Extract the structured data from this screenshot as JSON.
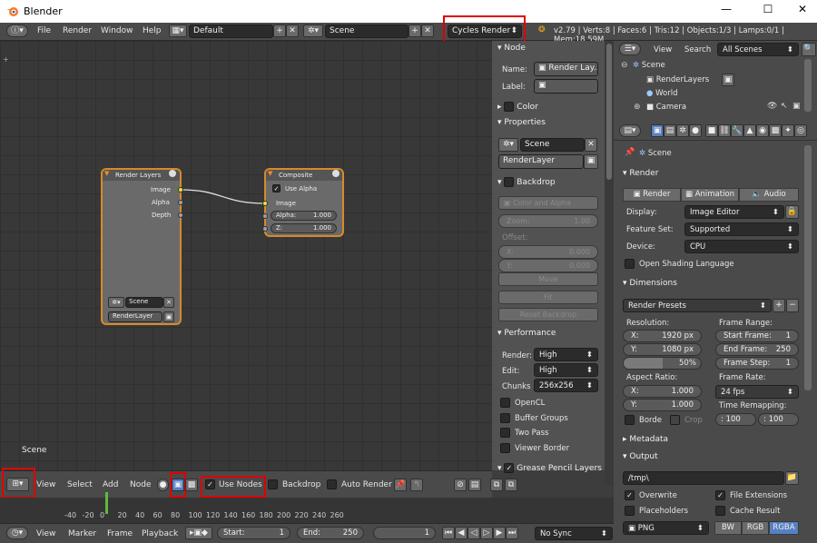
{
  "window": {
    "title": "Blender",
    "minimize": "—",
    "maximize": "☐",
    "close": "✕"
  },
  "topbar": {
    "menus": [
      "File",
      "Render",
      "Window",
      "Help"
    ],
    "layout": "Default",
    "scene": "Scene",
    "engine": "Cycles Render",
    "stats": "v2.79 | Verts:8 | Faces:6 | Tris:12 | Objects:1/3 | Lamps:0/1 | Mem:18.59M"
  },
  "node_editor": {
    "scene_label": "Scene",
    "render_layers_node": {
      "title": "Render Layers",
      "outputs": [
        "Image",
        "Alpha",
        "Depth"
      ],
      "scene": "Scene",
      "layer": "RenderLayer"
    },
    "composite_node": {
      "title": "Composite",
      "use_alpha": "Use Alpha",
      "image": "Image",
      "alpha_label": "Alpha:",
      "alpha_value": "1.000",
      "z_label": "Z:",
      "z_value": "1.000"
    }
  },
  "node_sidebar": {
    "node_header": "Node",
    "name_label": "Name:",
    "name_value": "Render Lay...",
    "label_label": "Label:",
    "color_header": "Color",
    "properties_header": "Properties",
    "scene": "Scene",
    "layer": "RenderLayer",
    "backdrop_header": "Backdrop",
    "color_alpha": "Color and Alpha",
    "zoom": "Zoom:",
    "zoom_value": "1.00",
    "offset": "Offset:",
    "x": "X:",
    "x_value": "0.000",
    "y": "Y:",
    "y_value": "0.000",
    "move": "Move",
    "fit": "Fit",
    "reset_backdrop": "Reset Backdrop",
    "performance_header": "Performance",
    "render_label": "Render:",
    "render_value": "High",
    "edit_label": "Edit:",
    "edit_value": "High",
    "chunks_label": "Chunks",
    "chunks_value": "256x256",
    "opencl": "OpenCL",
    "buffer_groups": "Buffer Groups",
    "two_pass": "Two Pass",
    "viewer_border": "Viewer Border",
    "grease_pencil": "Grease Pencil Layers"
  },
  "node_bar": {
    "menus": [
      "View",
      "Select",
      "Add",
      "Node"
    ],
    "use_nodes": "Use Nodes",
    "backdrop": "Backdrop",
    "auto_render": "Auto Render"
  },
  "timeline": {
    "ticks": [
      "-40",
      "-20",
      "0",
      "20",
      "40",
      "60",
      "80",
      "100",
      "120",
      "140",
      "160",
      "180",
      "200",
      "220",
      "240",
      "260"
    ],
    "menus": [
      "View",
      "Marker",
      "Frame",
      "Playback"
    ],
    "start_label": "Start:",
    "start_value": "1",
    "end_label": "End:",
    "end_value": "250",
    "current": "1",
    "sync": "No Sync"
  },
  "outliner": {
    "view": "View",
    "search": "Search",
    "filter": "All Scenes",
    "items": [
      "Scene",
      "RenderLayers",
      "World",
      "Camera"
    ]
  },
  "properties": {
    "scene": "Scene",
    "render_header": "Render",
    "render_btn": "Render",
    "animation_btn": "Animation",
    "audio_btn": "Audio",
    "display_label": "Display:",
    "display_value": "Image Editor",
    "feature_label": "Feature Set:",
    "feature_value": "Supported",
    "device_label": "Device:",
    "device_value": "CPU",
    "open_shading": "Open Shading Language",
    "dimensions_header": "Dimensions",
    "render_presets": "Render Presets",
    "resolution": "Resolution:",
    "res_x": "X:",
    "res_x_value": "1920 px",
    "res_y": "Y:",
    "res_y_value": "1080 px",
    "res_pct": "50%",
    "frame_range": "Frame Range:",
    "start_frame": "Start Frame:",
    "start_frame_value": "1",
    "end_frame": "End Frame:",
    "end_frame_value": "250",
    "frame_step": "Frame Step:",
    "frame_step_value": "1",
    "aspect": "Aspect Ratio:",
    "asp_x": "X:",
    "asp_x_value": "1.000",
    "asp_y": "Y:",
    "asp_y_value": "1.000",
    "frame_rate": "Frame Rate:",
    "fps": "24 fps",
    "time_remap": "Time Remapping:",
    "remap_old": ": 100",
    "remap_new": ": 100",
    "border": "Borde",
    "crop": "Crop",
    "metadata_header": "Metadata",
    "output_header": "Output",
    "path": "/tmp\\",
    "overwrite": "Overwrite",
    "file_ext": "File Extensions",
    "placeholders": "Placeholders",
    "cache_result": "Cache Result",
    "format": "PNG",
    "bw": "BW",
    "rgb": "RGB",
    "rgba": "RGBA"
  },
  "colors": {
    "accent": "#5680c2",
    "highlight": "#e00000",
    "socket": "#e6e62a",
    "node_selected": "#d58a2a"
  }
}
